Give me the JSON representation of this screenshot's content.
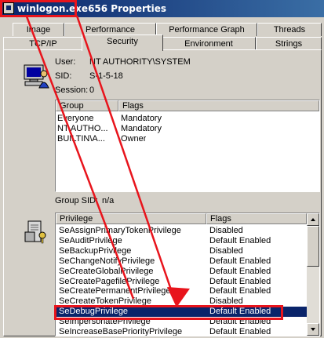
{
  "window": {
    "process_name": "winlogon.exe",
    "title_rest": "656 Properties"
  },
  "tabs_row1": [
    {
      "label": "Image"
    },
    {
      "label": "Performance"
    },
    {
      "label": "Performance Graph"
    },
    {
      "label": "Threads"
    }
  ],
  "tabs_row2": [
    {
      "label": "TCP/IP"
    },
    {
      "label": "Security"
    },
    {
      "label": "Environment"
    },
    {
      "label": "Strings"
    }
  ],
  "security": {
    "user_label": "User:",
    "user_value": "NT AUTHORITY\\SYSTEM",
    "sid_label": "SID:",
    "sid_value": "S-1-5-18",
    "session_label": "Session:",
    "session_value": "0",
    "groups_columns": [
      "Group",
      "Flags"
    ],
    "groups": [
      {
        "group": "Everyone",
        "flags": "Mandatory"
      },
      {
        "group": "NT AUTHO...",
        "flags": "Mandatory"
      },
      {
        "group": "BUILTIN\\A...",
        "flags": "Owner"
      }
    ],
    "group_sid_label": "Group SID:",
    "group_sid_value": "n/a",
    "privileges_columns": [
      "Privilege",
      "Flags"
    ],
    "privileges": [
      {
        "privilege": "SeAssignPrimaryTokenPrivilege",
        "flags": "Disabled"
      },
      {
        "privilege": "SeAuditPrivilege",
        "flags": "Default Enabled"
      },
      {
        "privilege": "SeBackupPrivilege",
        "flags": "Disabled"
      },
      {
        "privilege": "SeChangeNotifyPrivilege",
        "flags": "Default Enabled"
      },
      {
        "privilege": "SeCreateGlobalPrivilege",
        "flags": "Default Enabled"
      },
      {
        "privilege": "SeCreatePagefilePrivilege",
        "flags": "Default Enabled"
      },
      {
        "privilege": "SeCreatePermanentPrivilege",
        "flags": "Default Enabled"
      },
      {
        "privilege": "SeCreateTokenPrivilege",
        "flags": "Disabled"
      },
      {
        "privilege": "SeDebugPrivilege",
        "flags": "Default Enabled"
      },
      {
        "privilege": "SeImpersonatePrivilege",
        "flags": "Default Enabled"
      },
      {
        "privilege": "SeIncreaseBasePriorityPrivilege",
        "flags": "Default Enabled"
      }
    ],
    "selected_privilege_index": 8
  },
  "icons": {
    "title": "app-icon",
    "user": "computer-user-icon",
    "privileges": "server-key-icon"
  },
  "colors": {
    "annotation": "#e8141c",
    "selection": "#0a246a",
    "titlebar": "#0a246a"
  }
}
